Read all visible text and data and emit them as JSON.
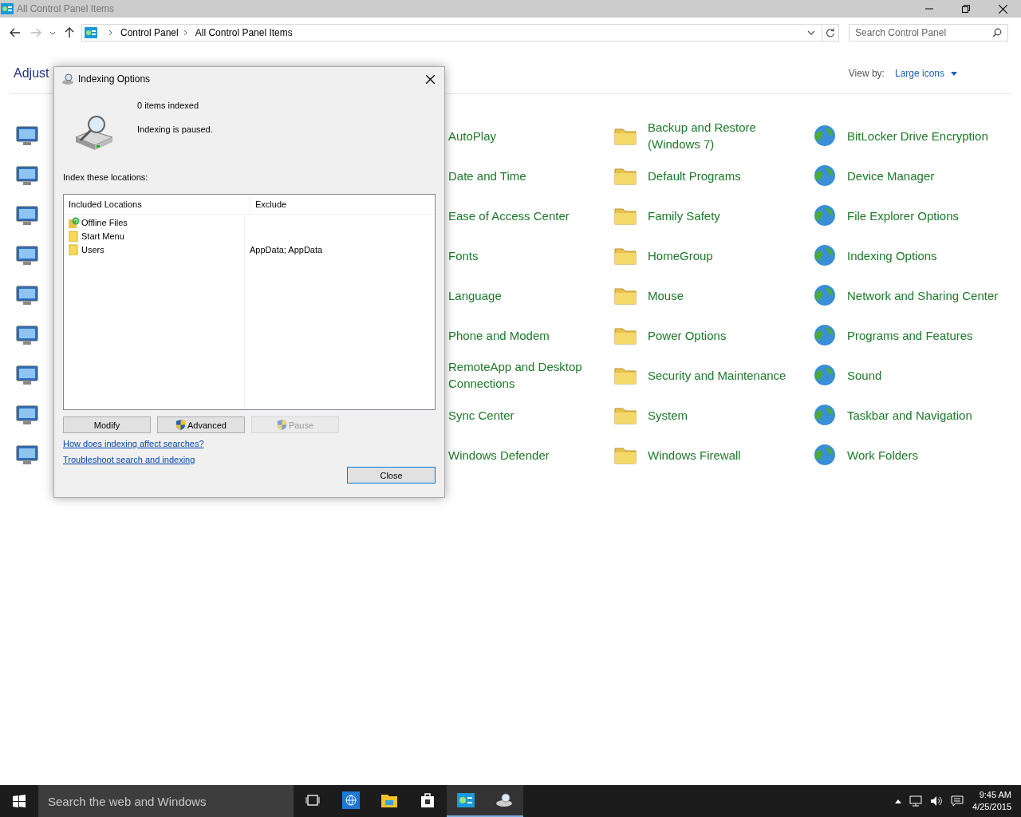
{
  "window": {
    "title": "All Control Panel Items"
  },
  "address_bar": {
    "crumbs": [
      "Control Panel",
      "All Control Panel Items"
    ]
  },
  "search": {
    "placeholder": "Search Control Panel"
  },
  "heading": "Adjust",
  "view_by": {
    "label": "View by:",
    "value": "Large icons"
  },
  "items": [
    {
      "column_3": "AutoPlay",
      "column_4": "Backup and Restore (Windows 7)",
      "column_5": "BitLocker Drive Encryption"
    },
    {
      "column_3": "Date and Time",
      "column_4": "Default Programs",
      "column_5": "Device Manager"
    },
    {
      "column_3": "Ease of Access Center",
      "column_4": "Family Safety",
      "column_5": "File Explorer Options"
    },
    {
      "column_3": "Fonts",
      "column_4": "HomeGroup",
      "column_5": "Indexing Options"
    },
    {
      "column_3": "Language",
      "column_4": "Mouse",
      "column_5": "Network and Sharing Center"
    },
    {
      "column_3": "Phone and Modem",
      "column_4": "Power Options",
      "column_5": "Programs and Features"
    },
    {
      "column_3": "RemoteApp and Desktop Connections",
      "column_4": "Security and Maintenance",
      "column_5": "Sound"
    },
    {
      "column_3": "Sync Center",
      "column_4": "System",
      "column_5": "Taskbar and Navigation"
    },
    {
      "column_3": "Windows Defender",
      "column_4": "Windows Firewall",
      "column_5": "Work Folders"
    }
  ],
  "dialog": {
    "title": "Indexing Options",
    "count": "0 items indexed",
    "status": "Indexing is paused.",
    "section_label": "Index these locations:",
    "columns": [
      "Included Locations",
      "Exclude"
    ],
    "locations": [
      {
        "kind": "offline",
        "name": "Offline Files"
      },
      {
        "kind": "folder",
        "name": "Start Menu"
      },
      {
        "kind": "folder",
        "name": "Users",
        "exclude": "AppData; AppData"
      }
    ],
    "buttons": [
      {
        "label": "Modify",
        "shield": false,
        "disabled": false
      },
      {
        "label": "Advanced",
        "shield": true,
        "disabled": false
      },
      {
        "label": "Pause",
        "shield": true,
        "disabled": true
      }
    ],
    "links": [
      "How does indexing affect searches?",
      "Troubleshoot search and indexing"
    ],
    "close": "Close"
  },
  "taskbar": {
    "search_placeholder": "Search the web and Windows",
    "apps": [
      {
        "kind": "task-view",
        "active": false
      },
      {
        "kind": "browser",
        "active": false
      },
      {
        "kind": "explorer",
        "active": false
      },
      {
        "kind": "store",
        "active": false
      },
      {
        "kind": "control-panel",
        "active": true
      },
      {
        "kind": "indexing",
        "active": true
      }
    ],
    "time": "9:45 AM",
    "date": "4/25/2015"
  }
}
